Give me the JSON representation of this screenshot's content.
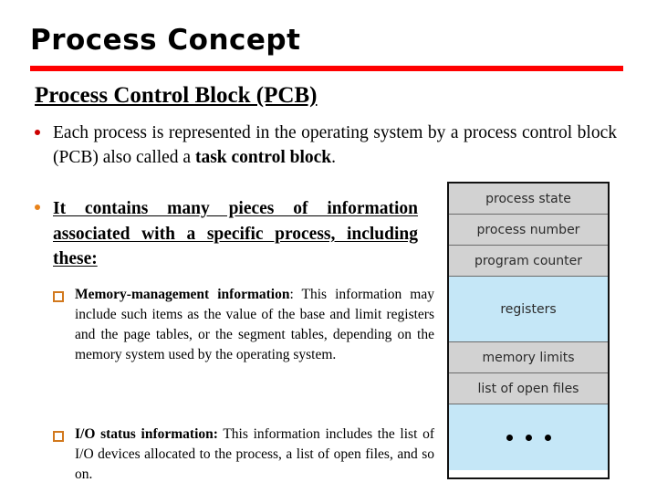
{
  "slide": {
    "title": "Process Concept",
    "subtitle": "Process Control Block (PCB)",
    "accent_color": "#ff0000",
    "bullet_red": "#cc0000",
    "bullet_orange": "#e8821a",
    "square_orange": "#d2791e",
    "diagram_gray": "#d2d2d2",
    "diagram_blue": "#c5e7f7"
  },
  "bullets": [
    {
      "marker": "red-dot",
      "text_before_bold": "Each process is represented in the operating system by a process control block (PCB) also called a ",
      "bold": "task control block",
      "text_after_bold": "."
    },
    {
      "marker": "orange-dot",
      "text": "It contains many pieces of information associated  with  a  specific  process, including these:"
    }
  ],
  "sub_bullets": [
    {
      "marker": "orange-square",
      "bold": "Memory-management information",
      "text": ": This information may include such items as the value of the base and limit registers and the page tables, or the segment tables, depending on the memory system used by the operating system."
    },
    {
      "marker": "orange-square",
      "bold": "I/O status information:",
      "text": " This information includes the list of I/O devices allocated to the process, a list of open files, and so on."
    }
  ],
  "pcb_diagram": {
    "rows": [
      {
        "label": "process state",
        "fill": "gray",
        "size": "small"
      },
      {
        "label": "process number",
        "fill": "gray",
        "size": "small"
      },
      {
        "label": "program counter",
        "fill": "gray",
        "size": "small"
      },
      {
        "label": "registers",
        "fill": "blue",
        "size": "tall"
      },
      {
        "label": "memory limits",
        "fill": "gray",
        "size": "small"
      },
      {
        "label": "list of open files",
        "fill": "gray",
        "size": "small"
      },
      {
        "label": "",
        "fill": "blue",
        "size": "dots"
      }
    ]
  }
}
